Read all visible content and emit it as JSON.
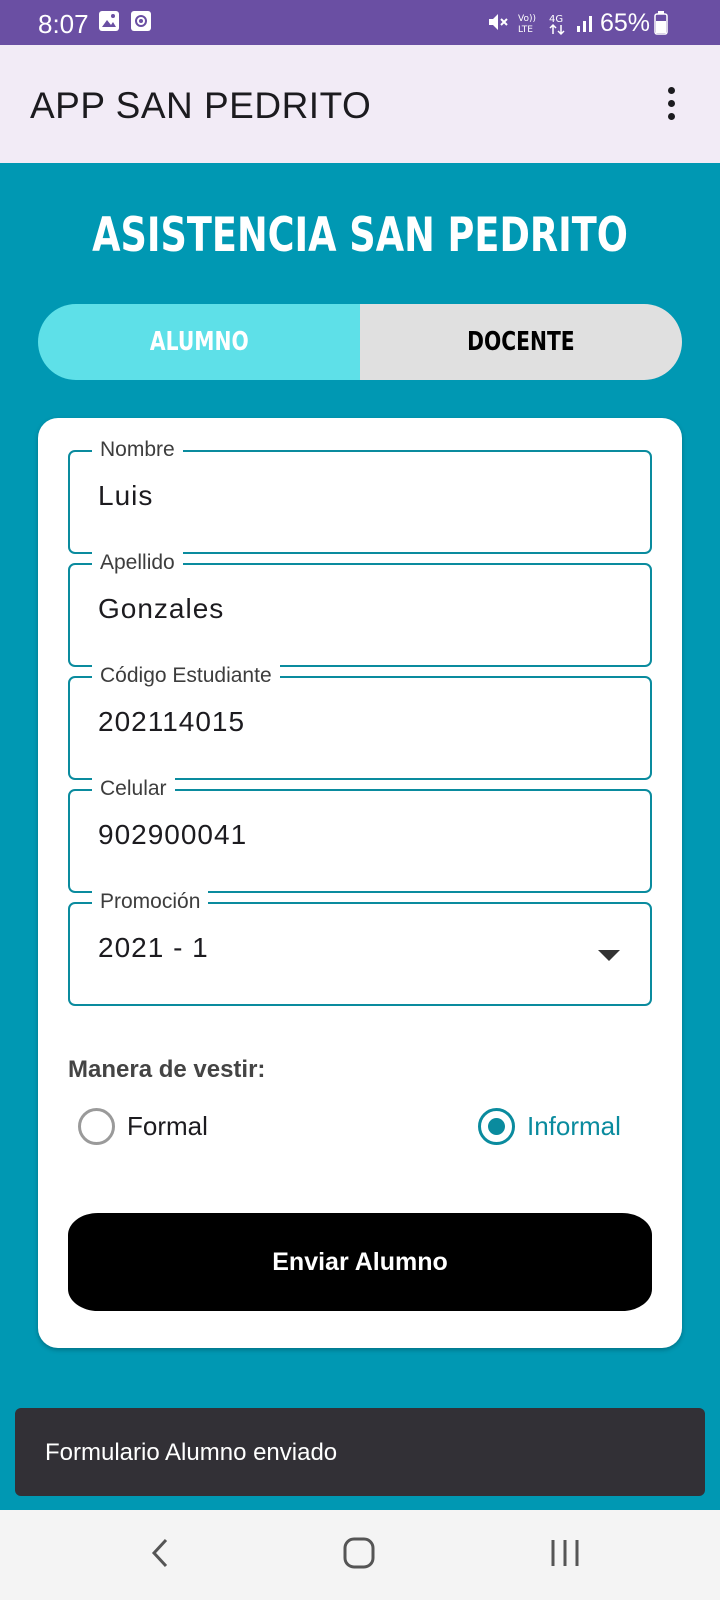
{
  "status_bar": {
    "time": "8:07",
    "battery": "65%",
    "icons": [
      "image-icon",
      "screen-record-icon",
      "mute-icon",
      "volte-icon",
      "4g-icon",
      "signal-icon",
      "battery-icon"
    ]
  },
  "app_bar": {
    "title": "APP SAN PEDRITO",
    "menu_icon": "more-vert-icon"
  },
  "heading": "ASISTENCIA SAN PEDRITO",
  "tabs": [
    {
      "label": "ALUMNO",
      "selected": true
    },
    {
      "label": "DOCENTE",
      "selected": false
    }
  ],
  "form": {
    "fields": [
      {
        "label": "Nombre",
        "value": "Luis"
      },
      {
        "label": "Apellido",
        "value": "Gonzales"
      },
      {
        "label": "Código Estudiante",
        "value": "202114015"
      },
      {
        "label": "Celular",
        "value": "902900041"
      },
      {
        "label": "Promoción",
        "value": "2021 - 1"
      }
    ],
    "dress_label": "Manera de vestir:",
    "options": [
      {
        "label": "Formal",
        "checked": false
      },
      {
        "label": "Informal",
        "checked": true
      }
    ],
    "submit_label": "Enviar Alumno"
  },
  "snackbar": "Formulario Alumno enviado",
  "nav_bar": {
    "icons": [
      "back-icon",
      "home-icon",
      "recents-icon"
    ]
  },
  "colors": {
    "status_bar": "#6a4fa3",
    "background": "#0098b3",
    "tab_selected": "#5ee0e8",
    "accent": "#0a8b9e"
  }
}
